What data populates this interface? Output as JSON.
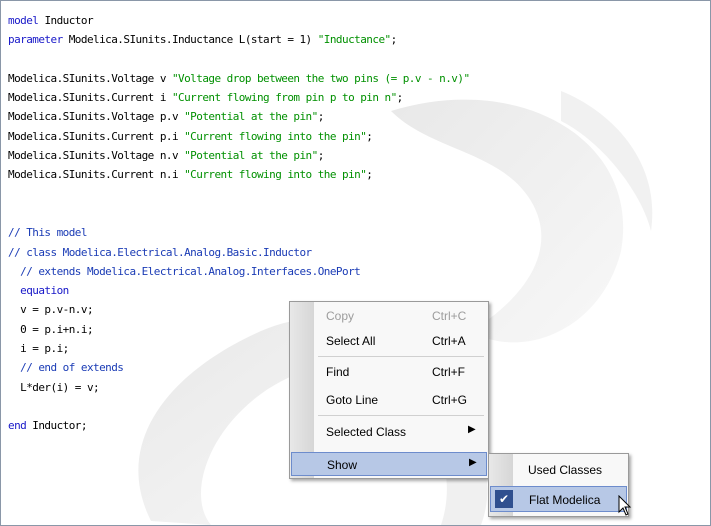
{
  "code_lines": [
    [
      {
        "t": "model",
        "c": "kw"
      },
      {
        "t": " Inductor",
        "c": ""
      }
    ],
    [
      {
        "t": "parameter",
        "c": "kw"
      },
      {
        "t": " Modelica.SIunits.Inductance L(start = 1) ",
        "c": ""
      },
      {
        "t": "\"Inductance\"",
        "c": "str"
      },
      {
        "t": ";",
        "c": ""
      }
    ],
    [],
    [
      {
        "t": "Modelica.SIunits.Voltage v ",
        "c": ""
      },
      {
        "t": "\"Voltage drop between the two pins (= p.v - n.v)\"",
        "c": "str"
      }
    ],
    [
      {
        "t": "Modelica.SIunits.Current i ",
        "c": ""
      },
      {
        "t": "\"Current flowing from pin p to pin n\"",
        "c": "str"
      },
      {
        "t": ";",
        "c": ""
      }
    ],
    [
      {
        "t": "Modelica.SIunits.Voltage p.v ",
        "c": ""
      },
      {
        "t": "\"Potential at the pin\"",
        "c": "str"
      },
      {
        "t": ";",
        "c": ""
      }
    ],
    [
      {
        "t": "Modelica.SIunits.Current p.i ",
        "c": ""
      },
      {
        "t": "\"Current flowing into the pin\"",
        "c": "str"
      },
      {
        "t": ";",
        "c": ""
      }
    ],
    [
      {
        "t": "Modelica.SIunits.Voltage n.v ",
        "c": ""
      },
      {
        "t": "\"Potential at the pin\"",
        "c": "str"
      },
      {
        "t": ";",
        "c": ""
      }
    ],
    [
      {
        "t": "Modelica.SIunits.Current n.i ",
        "c": ""
      },
      {
        "t": "\"Current flowing into the pin\"",
        "c": "str"
      },
      {
        "t": ";",
        "c": ""
      }
    ],
    [],
    [],
    [
      {
        "t": "// This model",
        "c": "cmt"
      }
    ],
    [
      {
        "t": "// class Modelica.Electrical.Analog.Basic.Inductor",
        "c": "cmt"
      }
    ],
    [
      {
        "t": "  // extends Modelica.Electrical.Analog.Interfaces.OnePort",
        "c": "cmt"
      }
    ],
    [
      {
        "t": "  equation",
        "c": "kw"
      }
    ],
    [
      {
        "t": "  v = p.v-n.v;",
        "c": ""
      }
    ],
    [
      {
        "t": "  0 = p.i+n.i;",
        "c": ""
      }
    ],
    [
      {
        "t": "  i = p.i;",
        "c": ""
      }
    ],
    [
      {
        "t": "  // end of extends",
        "c": "cmt"
      }
    ],
    [
      {
        "t": "  L*der(i) = v;",
        "c": ""
      }
    ],
    [],
    [
      {
        "t": "end",
        "c": "kw"
      },
      {
        "t": " Inductor;",
        "c": ""
      }
    ]
  ],
  "context_menu": {
    "copy": {
      "label": "Copy",
      "shortcut": "Ctrl+C"
    },
    "select_all": {
      "label": "Select All",
      "shortcut": "Ctrl+A"
    },
    "find": {
      "label": "Find",
      "shortcut": "Ctrl+F"
    },
    "goto_line": {
      "label": "Goto Line",
      "shortcut": "Ctrl+G"
    },
    "selected_class": {
      "label": "Selected Class"
    },
    "show": {
      "label": "Show"
    }
  },
  "submenu": {
    "used_classes": "Used Classes",
    "flat_modelica": "Flat Modelica"
  },
  "colors": {
    "keyword": "#1717c8",
    "string": "#009000",
    "comment": "#1a3bb5",
    "highlight": "#b7c8e6"
  },
  "icons": {
    "submenu_arrow": "arrow-right-icon",
    "check": "check-icon",
    "cursor": "mouse-pointer-icon"
  }
}
